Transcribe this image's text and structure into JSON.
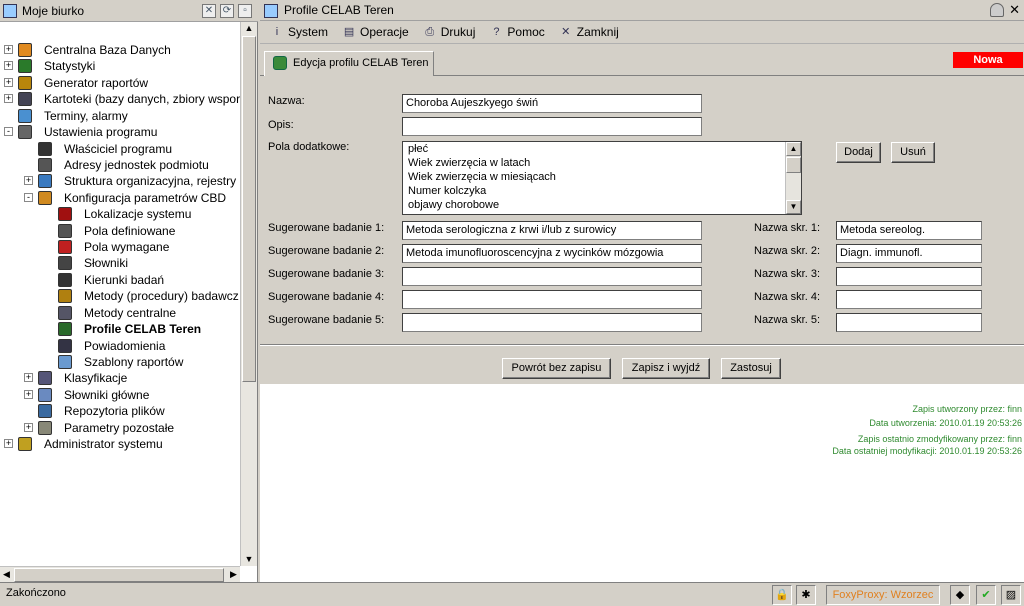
{
  "left_panel": {
    "title": "Moje biurko",
    "tree": [
      {
        "label": "Centralna Baza Danych",
        "icon": "database-icon",
        "expand": "+",
        "level": 0
      },
      {
        "label": "Statystyki",
        "icon": "chart-icon",
        "expand": "+",
        "level": 0
      },
      {
        "label": "Generator raportów",
        "icon": "report-generator-icon",
        "expand": "+",
        "level": 0
      },
      {
        "label": "Kartoteki (bazy danych, zbiory wspor",
        "icon": "card-file-icon",
        "expand": "+",
        "level": 0
      },
      {
        "label": "Terminy, alarmy",
        "icon": "alarm-icon",
        "expand": "",
        "level": 0
      },
      {
        "label": "Ustawienia programu",
        "icon": "settings-tools-icon",
        "expand": "-",
        "level": 0
      },
      {
        "label": "Właściciel programu",
        "icon": "owner-icon",
        "expand": "",
        "level": 1
      },
      {
        "label": "Adresy jednostek podmiotu",
        "icon": "address-icon",
        "expand": "",
        "level": 1
      },
      {
        "label": "Struktura organizacyjna, rejestry",
        "icon": "org-structure-icon",
        "expand": "+",
        "level": 1
      },
      {
        "label": "Konfiguracja parametrów CBD",
        "icon": "config-icon",
        "expand": "-",
        "level": 1
      },
      {
        "label": "Lokalizacje systemu",
        "icon": "location-icon",
        "expand": "",
        "level": 2
      },
      {
        "label": "Pola definiowane",
        "icon": "defined-fields-icon",
        "expand": "",
        "level": 2
      },
      {
        "label": "Pola wymagane",
        "icon": "required-fields-icon",
        "expand": "",
        "level": 2
      },
      {
        "label": "Słowniki",
        "icon": "dictionary-icon",
        "expand": "",
        "level": 2
      },
      {
        "label": "Kierunki badań",
        "icon": "research-direction-icon",
        "expand": "",
        "level": 2
      },
      {
        "label": "Metody (procedury) badawcz",
        "icon": "methods-icon",
        "expand": "",
        "level": 2
      },
      {
        "label": "Metody centralne",
        "icon": "central-methods-icon",
        "expand": "",
        "level": 2
      },
      {
        "label": "Profile CELAB Teren",
        "icon": "profile-icon",
        "expand": "",
        "level": 2,
        "selected": true
      },
      {
        "label": "Powiadomienia",
        "icon": "notifications-icon",
        "expand": "",
        "level": 2
      },
      {
        "label": "Szablony raportów",
        "icon": "templates-icon",
        "expand": "",
        "level": 2
      },
      {
        "label": "Klasyfikacje",
        "icon": "classification-icon",
        "expand": "+",
        "level": 1
      },
      {
        "label": "Słowniki główne",
        "icon": "main-dictionary-icon",
        "expand": "+",
        "level": 1
      },
      {
        "label": "Repozytoria plików",
        "icon": "file-repository-icon",
        "expand": "",
        "level": 1
      },
      {
        "label": "Parametry pozostałe",
        "icon": "other-params-icon",
        "expand": "+",
        "level": 1
      },
      {
        "label": "Administrator systemu",
        "icon": "admin-keys-icon",
        "expand": "+",
        "level": 0
      }
    ]
  },
  "window": {
    "title": "Profile CELAB Teren",
    "menu": [
      {
        "label": "System",
        "icon": "info-icon",
        "glyph": "i"
      },
      {
        "label": "Operacje",
        "icon": "operations-icon",
        "glyph": "▤"
      },
      {
        "label": "Drukuj",
        "icon": "printer-icon",
        "glyph": "⎙"
      },
      {
        "label": "Pomoc",
        "icon": "help-icon",
        "glyph": "?"
      },
      {
        "label": "Zamknij",
        "icon": "close-icon",
        "glyph": "✕"
      }
    ],
    "tab_label": "Edycja profilu CELAB Teren",
    "badge": "Nowa"
  },
  "form": {
    "nazwa_label": "Nazwa:",
    "nazwa_value": "Choroba Aujeszkyego świń",
    "opis_label": "Opis:",
    "opis_value": "",
    "pola_label": "Pola dodatkowe:",
    "pola_items": [
      "płeć",
      "Wiek zwierzęcia w latach",
      "Wiek zwierzęcia w miesiącach",
      "Numer kolczyka",
      "objawy chorobowe"
    ],
    "dodaj": "Dodaj",
    "usun": "Usuń",
    "badania": [
      {
        "label": "Sugerowane badanie 1:",
        "value": "Metoda serologiczna z krwi i/lub z surowicy",
        "short_label": "Nazwa skr. 1:",
        "short_value": "Metoda sereolog."
      },
      {
        "label": "Sugerowane badanie 2:",
        "value": "Metoda imunofluoroscencyjna z wycinków mózgowia",
        "short_label": "Nazwa skr. 2:",
        "short_value": "Diagn. immunofl."
      },
      {
        "label": "Sugerowane badanie 3:",
        "value": "",
        "short_label": "Nazwa skr. 3:",
        "short_value": ""
      },
      {
        "label": "Sugerowane badanie 4:",
        "value": "",
        "short_label": "Nazwa skr. 4:",
        "short_value": ""
      },
      {
        "label": "Sugerowane badanie 5:",
        "value": "",
        "short_label": "Nazwa skr. 5:",
        "short_value": ""
      }
    ],
    "btn_return": "Powrót bez zapisu",
    "btn_save_exit": "Zapisz i wyjdź",
    "btn_apply": "Zastosuj"
  },
  "meta": {
    "created_by": "Zapis utworzony przez: finn",
    "created_at": "Data utworzenia: 2010.01.19 20:53:26",
    "modified_by": "Zapis ostatnio zmodyfikowany przez: finn",
    "modified_at": "Data ostatniej modyfikacji: 2010.01.19 20:53:26"
  },
  "status": {
    "text": "Zakończono",
    "foxy": "FoxyProxy: Wzorzec"
  },
  "colors": {
    "badge": "#ff0000",
    "meta_text": "#2f8a2f",
    "foxy_text": "#e08020"
  }
}
